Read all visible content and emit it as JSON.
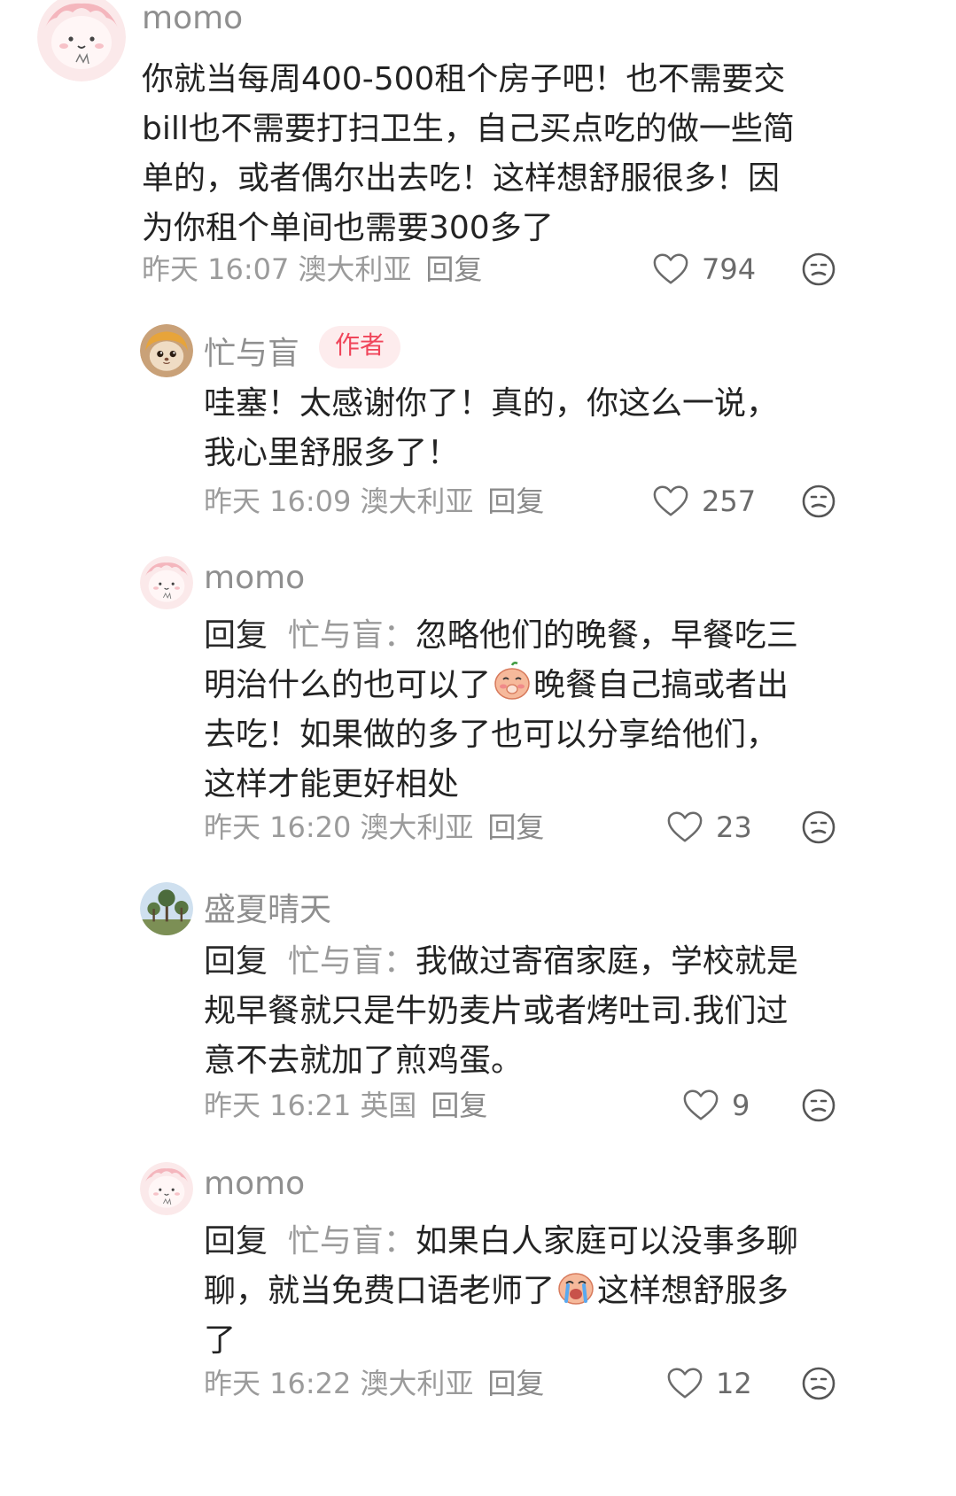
{
  "comments": [
    {
      "username": "momo",
      "text_lines": [
        "你就当每周400-500租个房子吧！也不需要交",
        "bill也不需要打扫卫生，自己买点吃的做一些简",
        "单的，或者偶尔出去吃！这样想舒服很多！因",
        "为你租个单间也需要300多了"
      ],
      "time": "昨天 16:07",
      "location": "澳大利亚",
      "reply_label": "回复",
      "likes": "794"
    },
    {
      "username": "忙与盲",
      "badge": "作者",
      "text_lines": [
        "哇塞！太感谢你了！真的，你这么一说，",
        "我心里舒服多了！"
      ],
      "time": "昨天 16:09",
      "location": "澳大利亚",
      "reply_label": "回复",
      "likes": "257"
    },
    {
      "username": "momo",
      "reply_prefix": "回复",
      "reply_target": "忙与盲：",
      "line1": "忽略他们的晚餐，早餐吃三",
      "line2a": "明治什么的也可以了",
      "line2b": "晚餐自己搞或者出",
      "line3": "去吃！如果做的多了也可以分享给他们，",
      "line4": "这样才能更好相处",
      "time": "昨天 16:20",
      "location": "澳大利亚",
      "reply_label": "回复",
      "likes": "23"
    },
    {
      "username": "盛夏晴天",
      "reply_prefix": "回复",
      "reply_target": "忙与盲：",
      "line1": "我做过寄宿家庭，学校就是",
      "line2": "规早餐就只是牛奶麦片或者烤吐司.我们过",
      "line3": "意不去就加了煎鸡蛋。",
      "time": "昨天 16:21",
      "location": "英国",
      "reply_label": "回复",
      "likes": "9"
    },
    {
      "username": "momo",
      "reply_prefix": "回复",
      "reply_target": "忙与盲：",
      "line1": "如果白人家庭可以没事多聊",
      "line2a": "聊，就当免费口语老师了",
      "line2b": "这样想舒服多",
      "line3": "了",
      "time": "昨天 16:22",
      "location": "澳大利亚",
      "reply_label": "回复",
      "likes": "12"
    }
  ],
  "colors": {
    "author_badge_bg": "#fdeced",
    "author_badge_text": "#f0455a",
    "meta_gray": "#9b9b9b"
  },
  "icons": [
    "heart-icon",
    "dislike-face-icon",
    "blushing-emoji",
    "crying-emoji"
  ]
}
